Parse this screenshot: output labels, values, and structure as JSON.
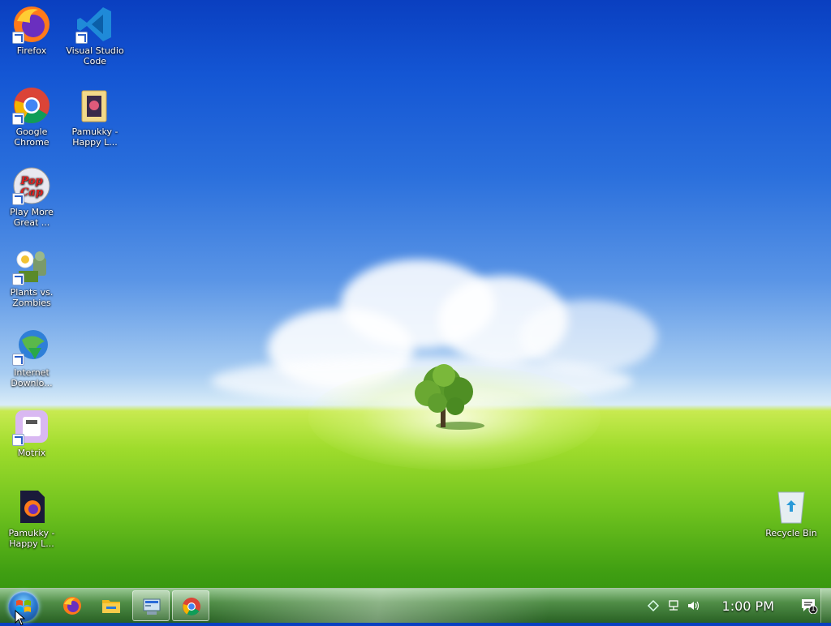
{
  "desktop": {
    "icons": [
      {
        "label": "Firefox"
      },
      {
        "label": "Visual Studio Code"
      },
      {
        "label": "Google Chrome"
      },
      {
        "label": "Pamukky - Happy L..."
      },
      {
        "label": "Play More Great ..."
      },
      {
        "label": "Plants vs. Zombies"
      },
      {
        "label": "Internet Downlo..."
      },
      {
        "label": "Motrix"
      },
      {
        "label": "Pamukky - Happy L..."
      },
      {
        "label": "Recycle Bin"
      }
    ],
    "popcap_text_1": "Pop",
    "popcap_text_2": "Cap"
  },
  "taskbar": {
    "pinned": [
      {
        "icon": "firefox-icon"
      },
      {
        "icon": "file-explorer-icon"
      },
      {
        "icon": "control-panel-icon",
        "active": true
      },
      {
        "icon": "chrome-icon",
        "active": true
      }
    ],
    "clock": "1:00 PM",
    "notification_count": "1"
  },
  "colors": {
    "sky_top": "#0a3fc0",
    "grass": "#6fc21e",
    "taskbar": "#3a6a3a"
  }
}
